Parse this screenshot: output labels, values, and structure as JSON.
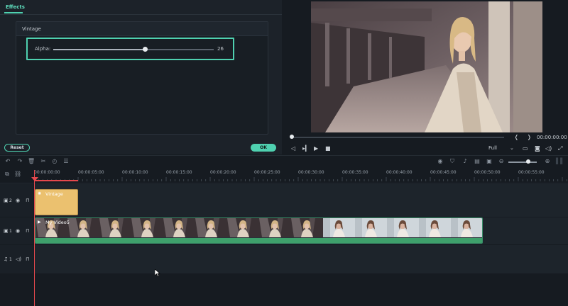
{
  "effects": {
    "tab_label": "Effects",
    "section_title": "Vintage",
    "alpha_label": "Alpha:",
    "alpha_value": "26",
    "alpha_fraction": 0.26,
    "reset_label": "Reset",
    "ok_label": "OK"
  },
  "preview": {
    "time": "00:00:00:00",
    "quality": "Full",
    "progress_fraction": 0.0
  },
  "ruler": {
    "labels": [
      "00:00:00:00",
      "00:00:05:00",
      "00:00:10:00",
      "00:00:15:00",
      "00:00:20:00",
      "00:00:25:00",
      "00:00:30:00",
      "00:00:35:00",
      "00:00:40:00",
      "00:00:45:00",
      "00:00:50:00",
      "00:00:55:00"
    ]
  },
  "tracks": [
    {
      "number": "2",
      "clip_label": "Vintage"
    },
    {
      "number": "1",
      "clip_label": "My Video5"
    },
    {
      "number": "1",
      "clip_label": ""
    }
  ],
  "colors": {
    "accent": "#4fd1b0",
    "playhead": "#e5484d",
    "effect_clip": "#ebc16f",
    "audio_wave": "#3ea06b"
  },
  "icons": [
    "undo-icon",
    "redo-icon",
    "delete-icon",
    "cut-icon",
    "speed-icon",
    "adjust-icon",
    "render-icon",
    "marker-icon",
    "mic-icon",
    "subtitle-icon",
    "audio-detach-icon",
    "zoom-out-icon",
    "zoom-in-icon",
    "eye-icon",
    "lock-icon",
    "mute-icon",
    "snap-icon",
    "link-icon",
    "prev-frame-icon",
    "play-icon",
    "stop-icon",
    "snapshot-icon",
    "volume-icon",
    "fullscreen-icon",
    "display-icon"
  ]
}
